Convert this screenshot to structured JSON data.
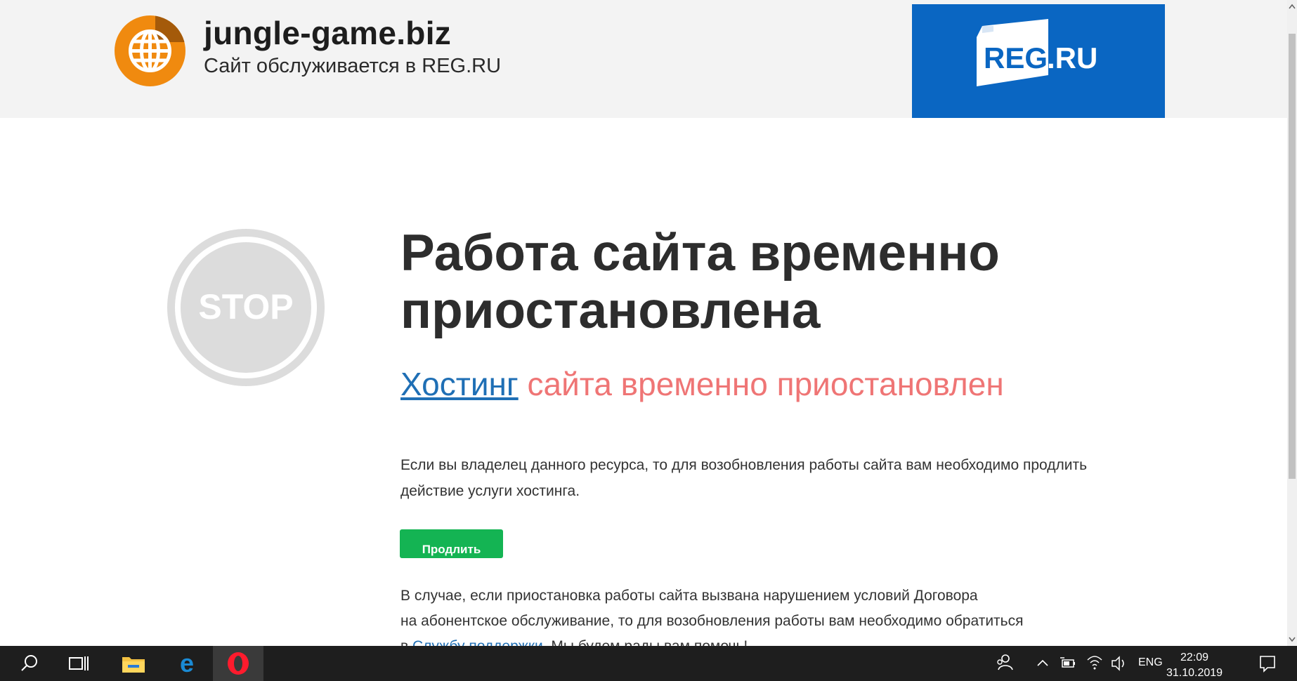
{
  "header": {
    "domain": "jungle-game.biz",
    "served_by": "Сайт обслуживается в REG.RU",
    "logo_text": "REG",
    "logo_suffix": ".RU",
    "colors": {
      "header_bg": "#f3f3f3",
      "logo_bg": "#0a66c2",
      "globe": "#f08a0f"
    }
  },
  "main": {
    "stop_label": "STOP",
    "headline_line1": "Работа сайта временно",
    "headline_line2": "приостановлена",
    "sub_link": "Хостинг",
    "sub_rest": "сайта временно приостановлен",
    "para1": "Если вы владелец данного ресурса, то для возобновления работы сайта вам необходимо продлить действие услуги хостинга.",
    "button_label": "Продлить",
    "para2_line1": "В случае, если приостановка работы сайта вызвана нарушением условий Договора",
    "para2_line2": "на абонентское обслуживание, то для возобновления работы вам необходимо обратиться",
    "para2_pre": "в",
    "para2_link": "Службу поддержки",
    "para2_post": ". Мы будем рады вам помочь!",
    "colors": {
      "sub_text": "#ef7575",
      "link": "#1f6fb5",
      "button": "#14b453"
    }
  },
  "taskbar": {
    "language": "ENG",
    "time": "22:09",
    "date": "31.10.2019",
    "icons": [
      "search-icon",
      "task-view-icon",
      "file-explorer-icon",
      "edge-icon",
      "opera-icon",
      "people-icon",
      "chevron-up-icon",
      "battery-icon",
      "wifi-icon",
      "volume-icon",
      "notification-icon"
    ]
  }
}
